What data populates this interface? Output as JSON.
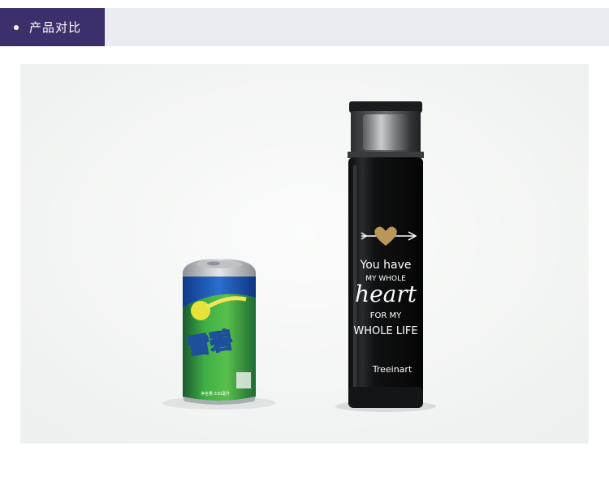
{
  "header": {
    "title": "产品对比"
  },
  "photo": {
    "can": {
      "brand_text": "雪碧",
      "volume_text": "净含量:330毫升"
    },
    "bottle": {
      "line1": "You have",
      "line2": "MY WHOLE",
      "line3": "heart",
      "line4": "FOR MY",
      "line5": "WHOLE LIFE",
      "brand": "Treeinart"
    }
  },
  "colors": {
    "header_accent": "#3d2f6b",
    "header_bar": "#ebebf2"
  }
}
